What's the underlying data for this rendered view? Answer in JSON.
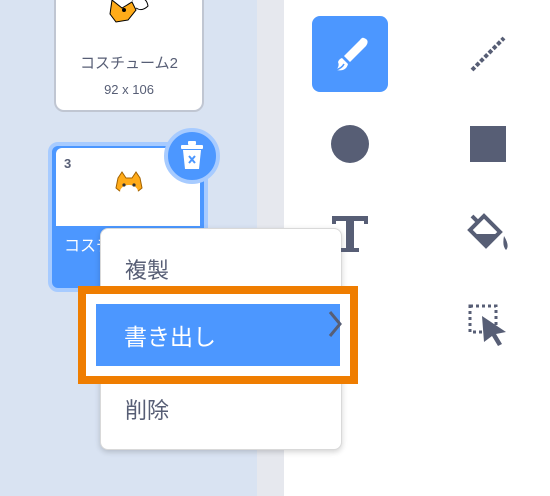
{
  "costumes": [
    {
      "name": "コスチューム2",
      "size": "92 x 106"
    },
    {
      "number": "3",
      "name": "コスチューム3"
    }
  ],
  "context_menu": {
    "items": [
      {
        "label": "複製"
      },
      {
        "label": "書き出し"
      },
      {
        "label": "削除"
      }
    ]
  },
  "colors": {
    "accent": "#4c97ff",
    "highlight": "#ef7d00",
    "text": "#575e75",
    "tool_icon": "#575e75"
  },
  "icons": {
    "delete": "trash-icon",
    "tools": [
      "brush-icon",
      "line-icon",
      "circle-icon",
      "rectangle-icon",
      "text-icon",
      "fill-icon",
      "eraser-icon",
      "select-icon"
    ]
  }
}
